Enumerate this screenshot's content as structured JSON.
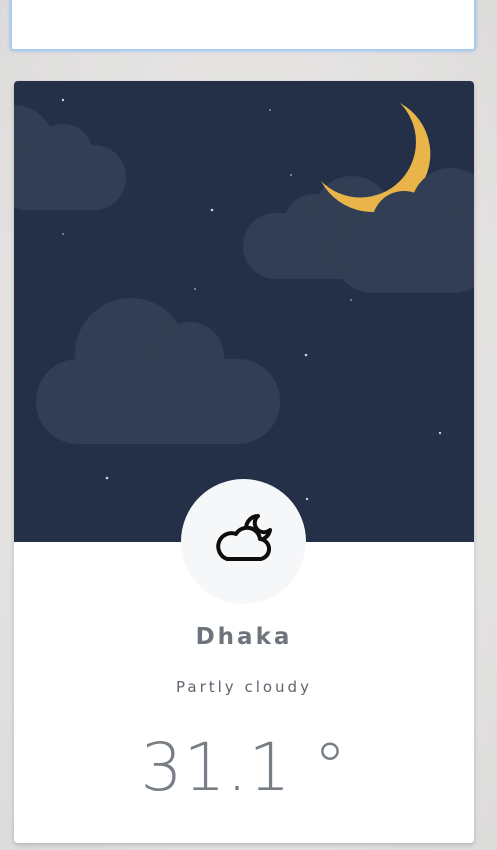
{
  "search": {
    "value": "",
    "placeholder": ""
  },
  "weather": {
    "city": "Dhaka",
    "condition": "Partly cloudy",
    "temperature": "31.1 °",
    "icon": "partly-cloudy-night-icon",
    "scene_icons": [
      "moon-icon",
      "cloud-icon",
      "star-icon"
    ]
  },
  "colors": {
    "sky": "#243047",
    "cloud": "#323e53",
    "moon": "#fbd879",
    "moon_shadow": "#e9b54a",
    "star": "#c9d3e2",
    "text": "#6e747b",
    "icon_circle": "#f6f7f9",
    "focus_border": "#a9cdee"
  }
}
